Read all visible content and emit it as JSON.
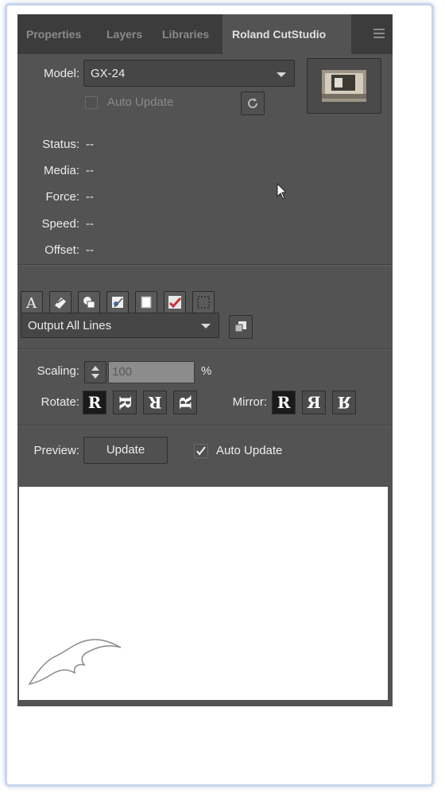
{
  "tabs": [
    {
      "label": "Properties",
      "active": false
    },
    {
      "label": "Layers",
      "active": false
    },
    {
      "label": "Libraries",
      "active": false
    },
    {
      "label": "Roland CutStudio",
      "active": true
    }
  ],
  "device": {
    "model_label": "Model:",
    "model_value": "GX-24",
    "auto_update_label": "Auto Update",
    "auto_update_checked": false
  },
  "status": [
    {
      "label": "Status:",
      "value": "--"
    },
    {
      "label": "Media:",
      "value": "--"
    },
    {
      "label": "Force:",
      "value": "--"
    },
    {
      "label": "Speed:",
      "value": "--"
    },
    {
      "label": "Offset:",
      "value": "--"
    }
  ],
  "tools": [
    "text-icon",
    "eraser-icon",
    "shapes-icon",
    "trace-icon",
    "page-icon",
    "checkmark-icon",
    "marquee-icon"
  ],
  "output": {
    "selected": "Output All Lines"
  },
  "scaling": {
    "label": "Scaling:",
    "value": "100",
    "unit": "%"
  },
  "rotate": {
    "label": "Rotate:",
    "options": [
      "R",
      "R",
      "R",
      "R"
    ],
    "selected": 0
  },
  "mirror": {
    "label": "Mirror:",
    "options": [
      "R",
      "Я",
      "R"
    ],
    "selected": 0
  },
  "preview": {
    "label": "Preview:",
    "update_button": "Update",
    "auto_update_label": "Auto Update",
    "auto_update_checked": true
  },
  "colors": {
    "panel": "#535353",
    "tabbar": "#3c3c3c",
    "accent_check": "#c8323c"
  }
}
